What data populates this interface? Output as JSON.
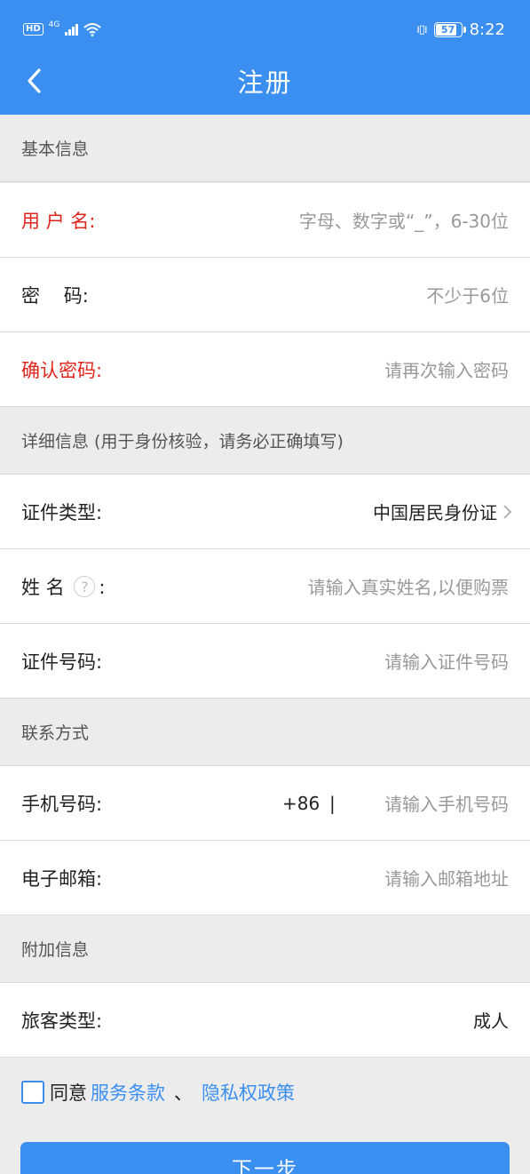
{
  "status_bar": {
    "hd": "HD",
    "network": "4G",
    "battery": "57",
    "time": "8:22"
  },
  "header": {
    "title": "注册",
    "back_icon": "chevron-left-icon"
  },
  "sections": {
    "basic": "基本信息",
    "detail": "详细信息 (用于身份核验，请务必正确填写)",
    "contact": "联系方式",
    "extra": "附加信息"
  },
  "fields": {
    "username": {
      "label": "用 户 名:",
      "placeholder": "字母、数字或“_”，6-30位"
    },
    "password": {
      "label": "密    码:",
      "placeholder": "不少于6位"
    },
    "confirm": {
      "label": "确认密码:",
      "placeholder": "请再次输入密码"
    },
    "id_type": {
      "label": "证件类型:",
      "value": "中国居民身份证"
    },
    "name": {
      "label": "姓 名",
      "help": "?",
      "colon": ":",
      "placeholder": "请输入真实姓名,以便购票"
    },
    "id_number": {
      "label": "证件号码:",
      "placeholder": "请输入证件号码"
    },
    "phone": {
      "label": "手机号码:",
      "country_code": "+86",
      "separator": "|",
      "placeholder": "请输入手机号码"
    },
    "email": {
      "label": "电子邮箱:",
      "placeholder": "请输入邮箱地址"
    },
    "passenger_type": {
      "label": "旅客类型:",
      "value": "成人"
    }
  },
  "agreement": {
    "checked": false,
    "prefix": "同意",
    "terms": "服务条款",
    "sep": "、",
    "privacy": "隐私权政策"
  },
  "next_button": "下一步",
  "colors": {
    "primary": "#3a8ff0",
    "required": "#e0241c",
    "placeholder": "#999999"
  }
}
